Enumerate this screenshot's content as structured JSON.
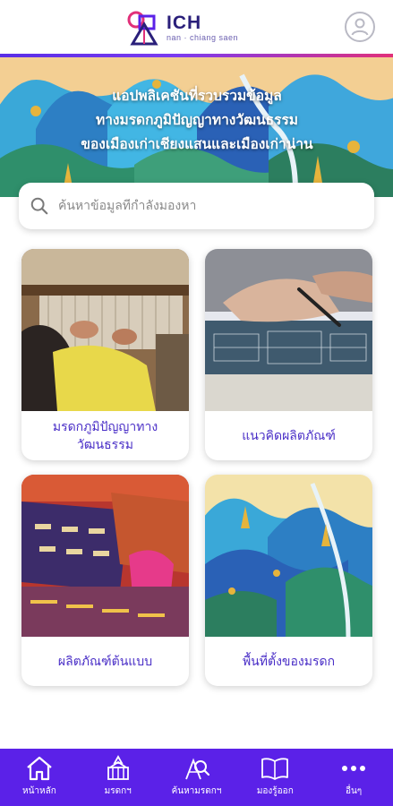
{
  "header": {
    "logo_title": "ICH",
    "logo_subtitle": "nan · chiang saen"
  },
  "banner": {
    "line1": "แอปพลิเคชันที่รวบรวมข้อมูล",
    "line2": "ทางมรดกภูมิปัญญาทางวัฒนธรรม",
    "line3": "ของเมืองเก่าเชียงแสนและเมืองเก่าน่าน"
  },
  "search": {
    "placeholder": "ค้นหาข้อมูลที่กำลังมองหา",
    "value": ""
  },
  "cards": [
    {
      "label": "มรดกภูมิปัญญาทางวัฒนธรรม"
    },
    {
      "label": "แนวคิดผลิตภัณฑ์"
    },
    {
      "label": "ผลิตภัณฑ์ต้นแบบ"
    },
    {
      "label": "พื้นที่ตั้งของมรดก"
    }
  ],
  "nav": [
    {
      "label": "หน้าหลัก",
      "icon": "home-icon"
    },
    {
      "label": "มรดกฯ",
      "icon": "temple-icon"
    },
    {
      "label": "ค้นหามรดกฯ",
      "icon": "search-heritage-icon"
    },
    {
      "label": "มองรู้ออก",
      "icon": "book-icon"
    },
    {
      "label": "อื่นๆ",
      "icon": "more-icon"
    }
  ],
  "colors": {
    "brand_purple": "#5b21e8",
    "label_purple": "#4a2fc7",
    "accent_pink": "#e1307a"
  }
}
